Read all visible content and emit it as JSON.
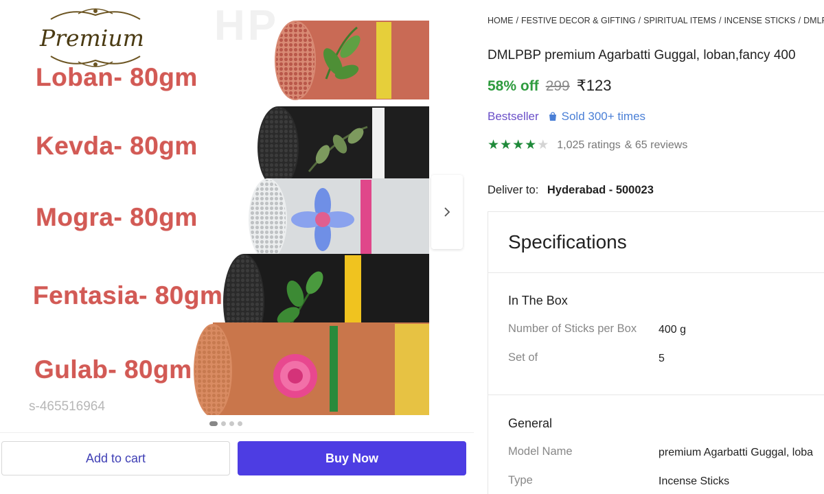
{
  "gallery": {
    "watermark": "HP",
    "premium_label": "Premium",
    "variants": [
      "Loban- 80gm",
      "Kevda- 80gm",
      "Mogra- 80gm",
      "Fentasia- 80gm",
      "Gulab- 80gm"
    ],
    "product_code": "s-465516964",
    "carousel": {
      "total": 4,
      "active_index": 0
    },
    "buttons": {
      "add_to_cart": "Add to cart",
      "buy_now": "Buy Now"
    },
    "icons": {
      "next": "chevron-right-icon"
    }
  },
  "breadcrumb": [
    "HOME",
    "FESTIVE DECOR & GIFTING",
    "SPIRITUAL ITEMS",
    "INCENSE STICKS",
    "DMLPBP"
  ],
  "product": {
    "title": "DMLPBP premium Agarbatti Guggal, loban,fancy 400",
    "discount": "58% off",
    "mrp": "299",
    "price": "₹123",
    "bestseller": "Bestseller",
    "sold": "Sold 300+ times",
    "rating": 4,
    "rating_max": 5,
    "ratings_count": "1,025 ratings",
    "reviews_count": "& 65 reviews",
    "deliver_label": "Deliver to:",
    "deliver_location": "Hyderabad - 500023"
  },
  "specifications": {
    "heading": "Specifications",
    "groups": [
      {
        "title": "In The Box",
        "rows": [
          {
            "key": "Number of Sticks per Box",
            "value": "400 g"
          },
          {
            "key": "Set of",
            "value": "5"
          }
        ]
      },
      {
        "title": "General",
        "rows": [
          {
            "key": "Model Name",
            "value": "premium Agarbatti Guggal, loba"
          },
          {
            "key": "Type",
            "value": "Incense Sticks"
          }
        ]
      }
    ]
  },
  "colors": {
    "discount": "#2e9b3e",
    "buy_button": "#4d3de3",
    "bestseller": "#6a4fc8",
    "star": "#1f8a3a",
    "variant_text": "#d25a55"
  }
}
